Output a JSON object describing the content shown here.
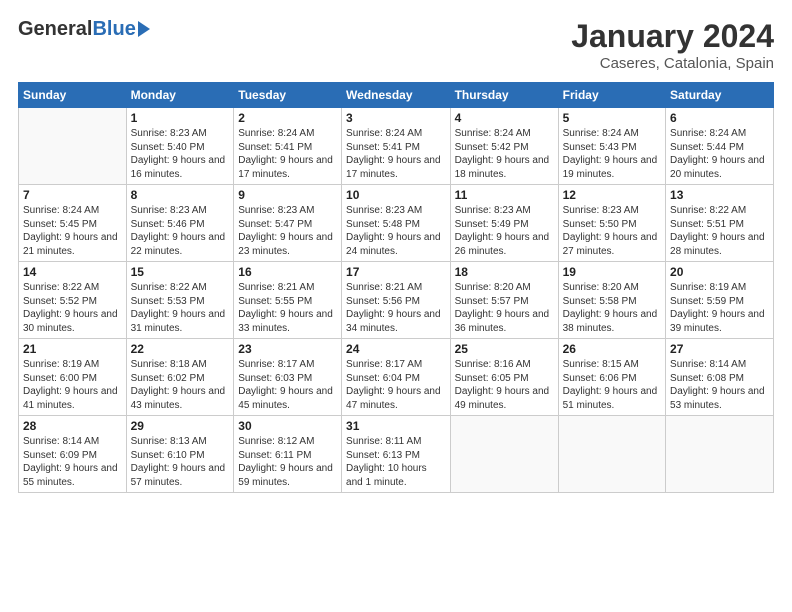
{
  "logo": {
    "general": "General",
    "blue": "Blue"
  },
  "title": "January 2024",
  "subtitle": "Caseres, Catalonia, Spain",
  "headers": [
    "Sunday",
    "Monday",
    "Tuesday",
    "Wednesday",
    "Thursday",
    "Friday",
    "Saturday"
  ],
  "weeks": [
    [
      {
        "day": "",
        "sunrise": "",
        "sunset": "",
        "daylight": ""
      },
      {
        "day": "1",
        "sunrise": "Sunrise: 8:23 AM",
        "sunset": "Sunset: 5:40 PM",
        "daylight": "Daylight: 9 hours and 16 minutes."
      },
      {
        "day": "2",
        "sunrise": "Sunrise: 8:24 AM",
        "sunset": "Sunset: 5:41 PM",
        "daylight": "Daylight: 9 hours and 17 minutes."
      },
      {
        "day": "3",
        "sunrise": "Sunrise: 8:24 AM",
        "sunset": "Sunset: 5:41 PM",
        "daylight": "Daylight: 9 hours and 17 minutes."
      },
      {
        "day": "4",
        "sunrise": "Sunrise: 8:24 AM",
        "sunset": "Sunset: 5:42 PM",
        "daylight": "Daylight: 9 hours and 18 minutes."
      },
      {
        "day": "5",
        "sunrise": "Sunrise: 8:24 AM",
        "sunset": "Sunset: 5:43 PM",
        "daylight": "Daylight: 9 hours and 19 minutes."
      },
      {
        "day": "6",
        "sunrise": "Sunrise: 8:24 AM",
        "sunset": "Sunset: 5:44 PM",
        "daylight": "Daylight: 9 hours and 20 minutes."
      }
    ],
    [
      {
        "day": "7",
        "sunrise": "Sunrise: 8:24 AM",
        "sunset": "Sunset: 5:45 PM",
        "daylight": "Daylight: 9 hours and 21 minutes."
      },
      {
        "day": "8",
        "sunrise": "Sunrise: 8:23 AM",
        "sunset": "Sunset: 5:46 PM",
        "daylight": "Daylight: 9 hours and 22 minutes."
      },
      {
        "day": "9",
        "sunrise": "Sunrise: 8:23 AM",
        "sunset": "Sunset: 5:47 PM",
        "daylight": "Daylight: 9 hours and 23 minutes."
      },
      {
        "day": "10",
        "sunrise": "Sunrise: 8:23 AM",
        "sunset": "Sunset: 5:48 PM",
        "daylight": "Daylight: 9 hours and 24 minutes."
      },
      {
        "day": "11",
        "sunrise": "Sunrise: 8:23 AM",
        "sunset": "Sunset: 5:49 PM",
        "daylight": "Daylight: 9 hours and 26 minutes."
      },
      {
        "day": "12",
        "sunrise": "Sunrise: 8:23 AM",
        "sunset": "Sunset: 5:50 PM",
        "daylight": "Daylight: 9 hours and 27 minutes."
      },
      {
        "day": "13",
        "sunrise": "Sunrise: 8:22 AM",
        "sunset": "Sunset: 5:51 PM",
        "daylight": "Daylight: 9 hours and 28 minutes."
      }
    ],
    [
      {
        "day": "14",
        "sunrise": "Sunrise: 8:22 AM",
        "sunset": "Sunset: 5:52 PM",
        "daylight": "Daylight: 9 hours and 30 minutes."
      },
      {
        "day": "15",
        "sunrise": "Sunrise: 8:22 AM",
        "sunset": "Sunset: 5:53 PM",
        "daylight": "Daylight: 9 hours and 31 minutes."
      },
      {
        "day": "16",
        "sunrise": "Sunrise: 8:21 AM",
        "sunset": "Sunset: 5:55 PM",
        "daylight": "Daylight: 9 hours and 33 minutes."
      },
      {
        "day": "17",
        "sunrise": "Sunrise: 8:21 AM",
        "sunset": "Sunset: 5:56 PM",
        "daylight": "Daylight: 9 hours and 34 minutes."
      },
      {
        "day": "18",
        "sunrise": "Sunrise: 8:20 AM",
        "sunset": "Sunset: 5:57 PM",
        "daylight": "Daylight: 9 hours and 36 minutes."
      },
      {
        "day": "19",
        "sunrise": "Sunrise: 8:20 AM",
        "sunset": "Sunset: 5:58 PM",
        "daylight": "Daylight: 9 hours and 38 minutes."
      },
      {
        "day": "20",
        "sunrise": "Sunrise: 8:19 AM",
        "sunset": "Sunset: 5:59 PM",
        "daylight": "Daylight: 9 hours and 39 minutes."
      }
    ],
    [
      {
        "day": "21",
        "sunrise": "Sunrise: 8:19 AM",
        "sunset": "Sunset: 6:00 PM",
        "daylight": "Daylight: 9 hours and 41 minutes."
      },
      {
        "day": "22",
        "sunrise": "Sunrise: 8:18 AM",
        "sunset": "Sunset: 6:02 PM",
        "daylight": "Daylight: 9 hours and 43 minutes."
      },
      {
        "day": "23",
        "sunrise": "Sunrise: 8:17 AM",
        "sunset": "Sunset: 6:03 PM",
        "daylight": "Daylight: 9 hours and 45 minutes."
      },
      {
        "day": "24",
        "sunrise": "Sunrise: 8:17 AM",
        "sunset": "Sunset: 6:04 PM",
        "daylight": "Daylight: 9 hours and 47 minutes."
      },
      {
        "day": "25",
        "sunrise": "Sunrise: 8:16 AM",
        "sunset": "Sunset: 6:05 PM",
        "daylight": "Daylight: 9 hours and 49 minutes."
      },
      {
        "day": "26",
        "sunrise": "Sunrise: 8:15 AM",
        "sunset": "Sunset: 6:06 PM",
        "daylight": "Daylight: 9 hours and 51 minutes."
      },
      {
        "day": "27",
        "sunrise": "Sunrise: 8:14 AM",
        "sunset": "Sunset: 6:08 PM",
        "daylight": "Daylight: 9 hours and 53 minutes."
      }
    ],
    [
      {
        "day": "28",
        "sunrise": "Sunrise: 8:14 AM",
        "sunset": "Sunset: 6:09 PM",
        "daylight": "Daylight: 9 hours and 55 minutes."
      },
      {
        "day": "29",
        "sunrise": "Sunrise: 8:13 AM",
        "sunset": "Sunset: 6:10 PM",
        "daylight": "Daylight: 9 hours and 57 minutes."
      },
      {
        "day": "30",
        "sunrise": "Sunrise: 8:12 AM",
        "sunset": "Sunset: 6:11 PM",
        "daylight": "Daylight: 9 hours and 59 minutes."
      },
      {
        "day": "31",
        "sunrise": "Sunrise: 8:11 AM",
        "sunset": "Sunset: 6:13 PM",
        "daylight": "Daylight: 10 hours and 1 minute."
      },
      {
        "day": "",
        "sunrise": "",
        "sunset": "",
        "daylight": ""
      },
      {
        "day": "",
        "sunrise": "",
        "sunset": "",
        "daylight": ""
      },
      {
        "day": "",
        "sunrise": "",
        "sunset": "",
        "daylight": ""
      }
    ]
  ]
}
